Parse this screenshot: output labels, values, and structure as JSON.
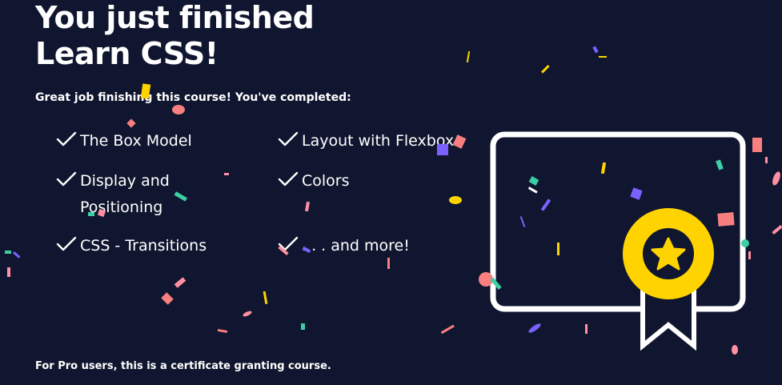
{
  "header": {
    "title_line1": "You just finished",
    "title_line2": "Learn CSS!"
  },
  "subtitle": "Great job finishing this course! You've completed:",
  "completed_items": [
    {
      "label": "The Box Model",
      "col": 0,
      "row": 0
    },
    {
      "label": "Layout with Flexbox",
      "col": 1,
      "row": 0
    },
    {
      "label": "Display and Positioning",
      "col": 0,
      "row": 1
    },
    {
      "label": "Colors",
      "col": 1,
      "row": 1
    },
    {
      "label": "CSS - Transitions",
      "col": 0,
      "row": 2
    },
    {
      "label": ". . . and more!",
      "col": 1,
      "row": 2
    }
  ],
  "footer": "For Pro users, this is a certificate granting course.",
  "icons": {
    "check": "check-icon",
    "certificate": "certificate-icon",
    "badge": "star-badge-icon"
  },
  "colors": {
    "background": "#10162f",
    "text": "#ffffff",
    "badge": "#ffd300",
    "confetti": [
      "#ffd300",
      "#f77f7f",
      "#3ccfa4",
      "#7b61ff",
      "#ff8fa3"
    ]
  }
}
